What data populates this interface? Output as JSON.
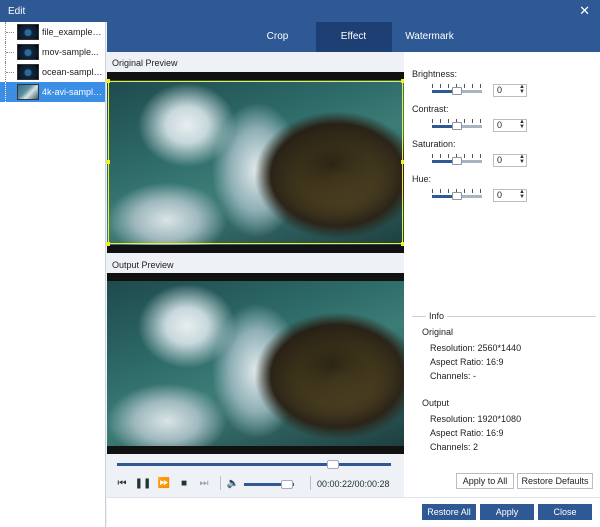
{
  "window": {
    "title": "Edit"
  },
  "files": [
    {
      "name": "file_example_...",
      "selected": false
    },
    {
      "name": "mov-sample...",
      "selected": false
    },
    {
      "name": "ocean-sample...",
      "selected": false
    },
    {
      "name": "4k-avi-sample...",
      "selected": true
    }
  ],
  "tabs": [
    {
      "label": "Crop",
      "active": false
    },
    {
      "label": "Effect",
      "active": true
    },
    {
      "label": "Watermark",
      "active": false
    }
  ],
  "preview": {
    "original_label": "Original Preview",
    "output_label": "Output Preview",
    "progress_fraction": 0.79,
    "volume_fraction": 0.85,
    "timecode": "00:00:22/00:00:28"
  },
  "effects": [
    {
      "label": "Brightness:",
      "value": "0"
    },
    {
      "label": "Contrast:",
      "value": "0"
    },
    {
      "label": "Saturation:",
      "value": "0"
    },
    {
      "label": "Hue:",
      "value": "0"
    }
  ],
  "info": {
    "title": "Info",
    "original_heading": "Original",
    "original_resolution": "Resolution: 2560*1440",
    "original_aspect": "Aspect Ratio: 16:9",
    "original_channels": "Channels: -",
    "output_heading": "Output",
    "output_resolution": "Resolution: 1920*1080",
    "output_aspect": "Aspect Ratio: 16:9",
    "output_channels": "Channels: 2"
  },
  "buttons": {
    "apply_to_all": "Apply to All",
    "restore_defaults": "Restore Defaults",
    "restore_all": "Restore All",
    "apply": "Apply",
    "close": "Close"
  },
  "colors": {
    "accent": "#2e5995",
    "active_tab": "#1e3f73",
    "selection": "#3b8ee5",
    "crop_box": "#f2ef2a"
  }
}
